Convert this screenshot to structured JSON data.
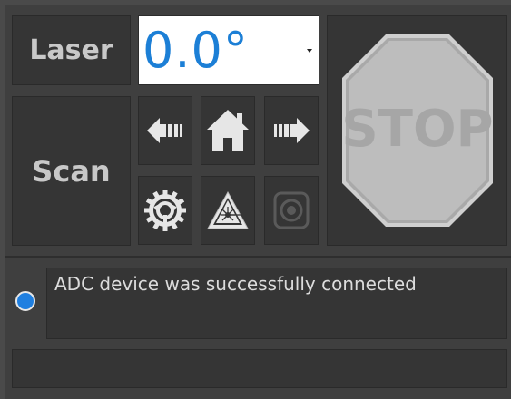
{
  "laser": {
    "label": "Laser",
    "angle_value": "0.0°",
    "accent_color": "#1c7fd6"
  },
  "scan": {
    "label": "Scan"
  },
  "controls": {
    "buttons": [
      {
        "icon": "arrow-left-icon",
        "enabled": true
      },
      {
        "icon": "home-icon",
        "enabled": true
      },
      {
        "icon": "arrow-right-icon",
        "enabled": true
      },
      {
        "icon": "gear-icon",
        "enabled": true
      },
      {
        "icon": "laser-warning-icon",
        "enabled": true
      },
      {
        "icon": "record-icon",
        "enabled": false
      }
    ]
  },
  "stop": {
    "label": "STOP",
    "icon": "stop-sign-icon",
    "enabled": false
  },
  "status": {
    "led_color": "#1f7fe0",
    "message": "ADC device was successfully connected"
  }
}
